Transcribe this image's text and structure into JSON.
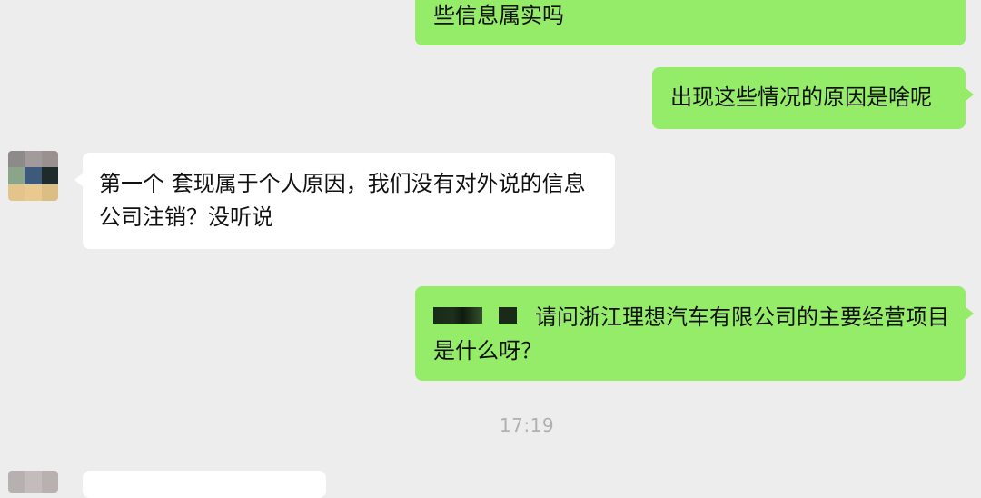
{
  "chat": {
    "messages": [
      {
        "side": "out",
        "text": "些信息属实吗"
      },
      {
        "side": "out",
        "text": "出现这些情况的原因是啥呢"
      },
      {
        "side": "in",
        "text": "第一个 套现属于个人原因，我们没有对外说的信息  公司注销？没听说"
      },
      {
        "side": "out",
        "text": "请问浙江理想汽车有限公司的主要经营项目是什么呀？"
      }
    ],
    "timestamp": "17:19"
  },
  "colors": {
    "background": "#ededed",
    "outgoing_bubble": "#95ec69",
    "incoming_bubble": "#ffffff",
    "timestamp_text": "#b0b0b0"
  },
  "icons": {
    "avatar": "pixelated-avatar-icon",
    "redaction": "redacted-mention-block"
  }
}
